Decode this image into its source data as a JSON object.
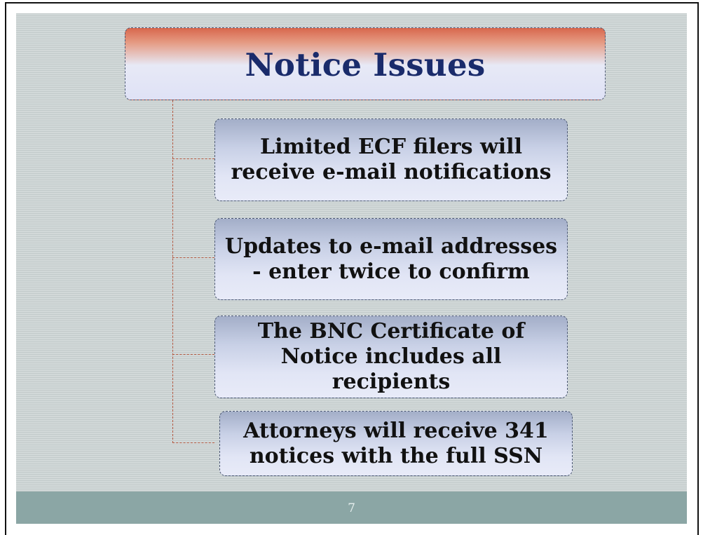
{
  "slide": {
    "title": "Notice Issues",
    "items": [
      {
        "lines": [
          "Limited ECF filers will",
          "receive e-mail notifications"
        ]
      },
      {
        "lines": [
          "Updates to e-mail addresses",
          "- enter twice to confirm"
        ]
      },
      {
        "lines": [
          "The BNC Certificate of",
          "Notice includes all",
          "recipients"
        ]
      },
      {
        "lines": [
          "Attorneys will receive 341",
          "notices with the full SSN"
        ]
      }
    ],
    "page_number": "7"
  },
  "colors": {
    "title_text": "#1a2b6b",
    "title_top": "#d8674d",
    "connector": "#b3573f",
    "footer": "#8ba6a5"
  }
}
